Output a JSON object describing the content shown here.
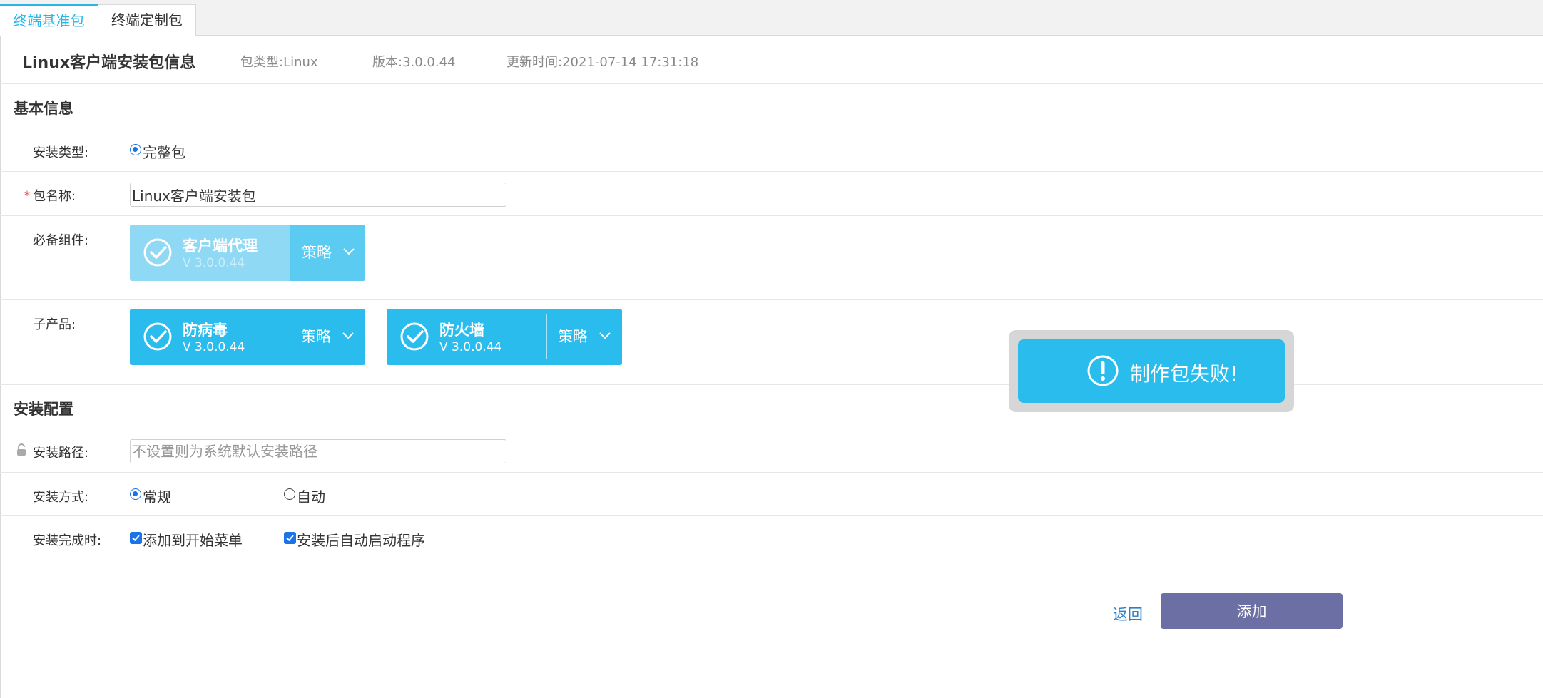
{
  "tabs": [
    {
      "label": "终端基准包",
      "active": true
    },
    {
      "label": "终端定制包",
      "active": false
    }
  ],
  "package_info": {
    "title": "Linux客户端安装包信息",
    "type": "包类型:Linux",
    "version": "版本:3.0.0.44",
    "updated": "更新时间:2021-07-14 17:31:18"
  },
  "basic_section": {
    "heading": "基本信息",
    "install_type_label": "安装类型:",
    "install_type_option": "完整包",
    "package_name_label": "包名称:",
    "required_marker": "*",
    "package_name_value": "Linux客户端安装包",
    "required_components_label": "必备组件:",
    "required_components": [
      {
        "name": "客户端代理",
        "version": "V 3.0.0.44",
        "dropdown": "策略",
        "disabled": true
      }
    ],
    "subproducts_label": "子产品:",
    "subproducts": [
      {
        "name": "防病毒",
        "version": "V 3.0.0.44",
        "dropdown": "策略"
      },
      {
        "name": "防火墙",
        "version": "V 3.0.0.44",
        "dropdown": "策略"
      }
    ]
  },
  "install_section": {
    "heading": "安装配置",
    "path_label": "安装路径:",
    "path_placeholder": "不设置则为系统默认安装路径",
    "mode_label": "安装方式:",
    "mode_options": [
      {
        "label": "常规",
        "selected": true
      },
      {
        "label": "自动",
        "selected": false
      }
    ],
    "completion_label": "安装完成时:",
    "completion_options": [
      {
        "label": "添加到开始菜单",
        "checked": true
      },
      {
        "label": "安装后自动启动程序",
        "checked": true
      }
    ]
  },
  "toast": {
    "message": "制作包失败!"
  },
  "actions": {
    "back": "返回",
    "add": "添加"
  },
  "colors": {
    "accent": "#2bbcee",
    "primary_button": "#6b6fa3",
    "link": "#2b7fc7"
  }
}
